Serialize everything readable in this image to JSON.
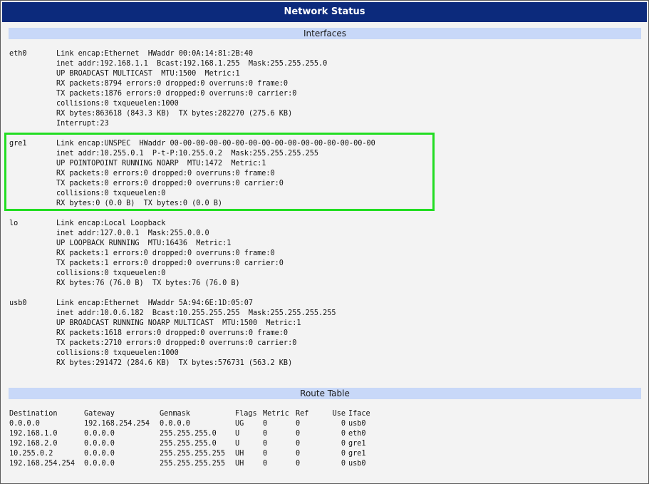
{
  "window": {
    "title": "Network Status"
  },
  "sections": {
    "interfaces": "Interfaces",
    "route_table": "Route Table"
  },
  "interfaces": [
    {
      "name": "eth0",
      "lines": [
        "Link encap:Ethernet  HWaddr 00:0A:14:81:2B:40",
        "inet addr:192.168.1.1  Bcast:192.168.1.255  Mask:255.255.255.0",
        "UP BROADCAST MULTICAST  MTU:1500  Metric:1",
        "RX packets:8794 errors:0 dropped:0 overruns:0 frame:0",
        "TX packets:1876 errors:0 dropped:0 overruns:0 carrier:0",
        "collisions:0 txqueuelen:1000",
        "RX bytes:863618 (843.3 KB)  TX bytes:282270 (275.6 KB)",
        "Interrupt:23"
      ]
    },
    {
      "name": "gre1",
      "highlighted": true,
      "lines": [
        "Link encap:UNSPEC  HWaddr 00-00-00-00-00-00-00-00-00-00-00-00-00-00-00-00",
        "inet addr:10.255.0.1  P-t-P:10.255.0.2  Mask:255.255.255.255",
        "UP POINTOPOINT RUNNING NOARP  MTU:1472  Metric:1",
        "RX packets:0 errors:0 dropped:0 overruns:0 frame:0",
        "TX packets:0 errors:0 dropped:0 overruns:0 carrier:0",
        "collisions:0 txqueuelen:0",
        "RX bytes:0 (0.0 B)  TX bytes:0 (0.0 B)"
      ]
    },
    {
      "name": "lo",
      "lines": [
        "Link encap:Local Loopback",
        "inet addr:127.0.0.1  Mask:255.0.0.0",
        "UP LOOPBACK RUNNING  MTU:16436  Metric:1",
        "RX packets:1 errors:0 dropped:0 overruns:0 frame:0",
        "TX packets:1 errors:0 dropped:0 overruns:0 carrier:0",
        "collisions:0 txqueuelen:0",
        "RX bytes:76 (76.0 B)  TX bytes:76 (76.0 B)"
      ]
    },
    {
      "name": "usb0",
      "lines": [
        "Link encap:Ethernet  HWaddr 5A:94:6E:1D:05:07",
        "inet addr:10.0.6.182  Bcast:10.255.255.255  Mask:255.255.255.255",
        "UP BROADCAST RUNNING NOARP MULTICAST  MTU:1500  Metric:1",
        "RX packets:1618 errors:0 dropped:0 overruns:0 frame:0",
        "TX packets:2710 errors:0 dropped:0 overruns:0 carrier:0",
        "collisions:0 txqueuelen:1000",
        "RX bytes:291472 (284.6 KB)  TX bytes:576731 (563.2 KB)"
      ]
    }
  ],
  "route_table": {
    "headers": [
      "Destination",
      "Gateway",
      "Genmask",
      "Flags",
      "Metric",
      "Ref",
      "Use",
      "Iface"
    ],
    "rows": [
      [
        "0.0.0.0",
        "192.168.254.254",
        "0.0.0.0",
        "UG",
        "0",
        "0",
        "0",
        "usb0"
      ],
      [
        "192.168.1.0",
        "0.0.0.0",
        "255.255.255.0",
        "U",
        "0",
        "0",
        "0",
        "eth0"
      ],
      [
        "192.168.2.0",
        "0.0.0.0",
        "255.255.255.0",
        "U",
        "0",
        "0",
        "0",
        "gre1"
      ],
      [
        "10.255.0.2",
        "0.0.0.0",
        "255.255.255.255",
        "UH",
        "0",
        "0",
        "0",
        "gre1"
      ],
      [
        "192.168.254.254",
        "0.0.0.0",
        "255.255.255.255",
        "UH",
        "0",
        "0",
        "0",
        "usb0"
      ]
    ]
  },
  "colors": {
    "titlebar": "#0c2a7c",
    "section_header": "#c8d8f8",
    "highlight": "#22dd22"
  }
}
